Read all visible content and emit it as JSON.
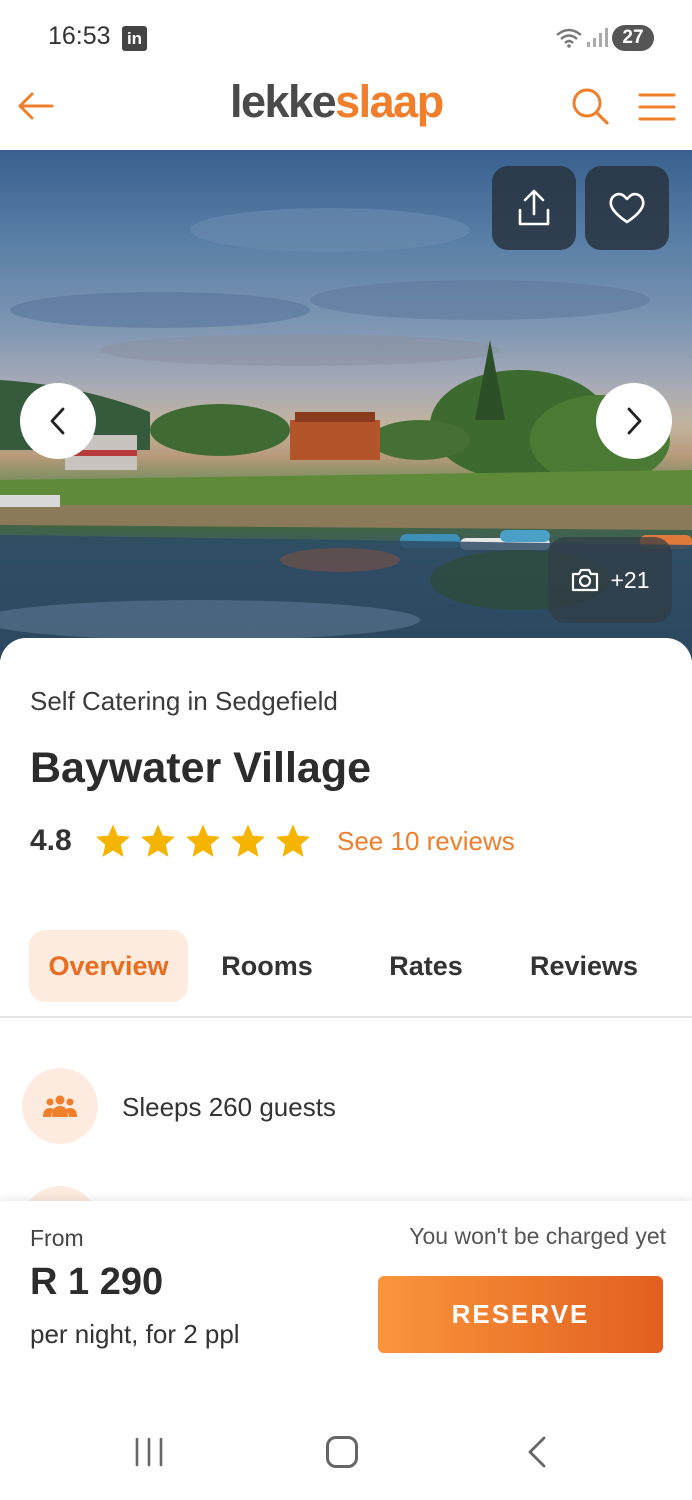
{
  "status_bar": {
    "time": "16:53",
    "notification_icon": "linkedin-icon",
    "battery": "27"
  },
  "header": {
    "logo_part1": "lekke",
    "logo_part2": "slaap",
    "brand_color": "#f07e2a",
    "back_icon": "arrow-left-icon",
    "search_icon": "search-icon",
    "menu_icon": "hamburger-menu-icon"
  },
  "hero": {
    "share_icon": "share-icon",
    "favorite_icon": "heart-icon",
    "prev_icon": "chevron-left-icon",
    "next_icon": "chevron-right-icon",
    "photo_count_label": "+21"
  },
  "listing": {
    "category": "Self Catering in Sedgefield",
    "title": "Baywater Village",
    "rating": "4.8",
    "stars": 5,
    "reviews_link": "See 10 reviews"
  },
  "tabs": [
    {
      "label": "Overview",
      "active": true
    },
    {
      "label": "Rooms",
      "active": false
    },
    {
      "label": "Rates",
      "active": false
    },
    {
      "label": "Reviews",
      "active": false
    }
  ],
  "amenities": [
    {
      "icon": "users-group-icon",
      "label": "Sleeps 260 guests"
    }
  ],
  "booking": {
    "from_label": "From",
    "price": "R 1 290",
    "per_night": "per night, for 2 ppl",
    "no_charge_note": "You won't be charged yet",
    "reserve_label": "RESERVE"
  }
}
